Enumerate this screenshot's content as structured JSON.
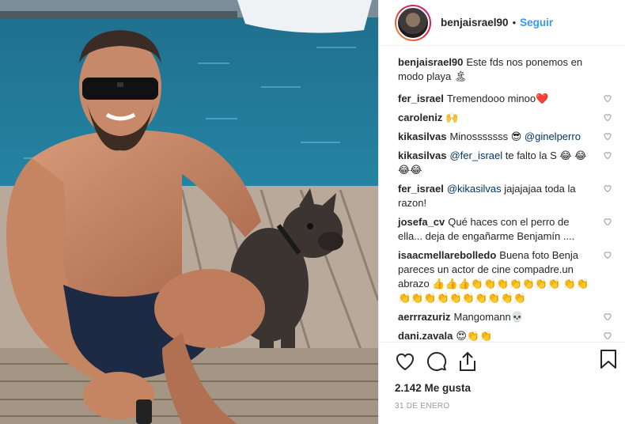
{
  "post": {
    "username": "benjaisrael90",
    "dot": "•",
    "follow_label": "Seguir",
    "caption": "Este fds nos ponemos en modo playa 🏝",
    "likes": "2.142 Me gusta",
    "date": "31 de enero"
  },
  "comments": [
    {
      "user": "fer_israel",
      "text": "Tremendooo minoo❤️"
    },
    {
      "user": "caroleniz",
      "text": "🙌"
    },
    {
      "user": "kikasilvas",
      "text": "Minosssssss 😎 ",
      "mention": "@ginelperro"
    },
    {
      "user": "kikasilvas",
      "mention_first": "@fer_israel",
      "text": " te falto la S 😂 😂😂😂"
    },
    {
      "user": "fer_israel",
      "mention_first": "@kikasilvas",
      "text": " jajajajaa toda la razon!"
    },
    {
      "user": "josefa_cv",
      "text": "Qué haces con el perro de ella... deja de engañarme Benjamín ...."
    },
    {
      "user": "isaacmellarebolledo",
      "text": "Buena foto Benja pareces un actor de cine compadre.un abrazo 👍👍👍👏👏👏👏👏👏👏 👏👏👏👏👏👏👏👏👏👏👏👏"
    },
    {
      "user": "aerrrazuriz",
      "text": "Mangomann💀"
    },
    {
      "user": "dani.zavala",
      "text": "😍👏👏"
    }
  ],
  "colors": {
    "accent": "#3897f0",
    "mention": "#003569",
    "text": "#262626",
    "muted": "#999999"
  },
  "icons": [
    "heart-icon",
    "comment-icon",
    "share-icon",
    "bookmark-icon"
  ]
}
